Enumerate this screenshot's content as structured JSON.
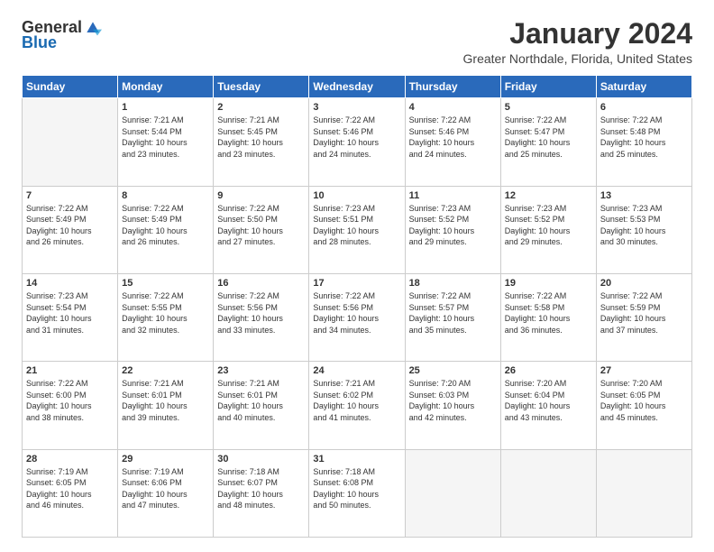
{
  "logo": {
    "general": "General",
    "blue": "Blue"
  },
  "header": {
    "month": "January 2024",
    "location": "Greater Northdale, Florida, United States"
  },
  "days_of_week": [
    "Sunday",
    "Monday",
    "Tuesday",
    "Wednesday",
    "Thursday",
    "Friday",
    "Saturday"
  ],
  "weeks": [
    [
      {
        "day": "",
        "sunrise": "",
        "sunset": "",
        "daylight": ""
      },
      {
        "day": "1",
        "sunrise": "Sunrise: 7:21 AM",
        "sunset": "Sunset: 5:44 PM",
        "daylight": "Daylight: 10 hours and 23 minutes."
      },
      {
        "day": "2",
        "sunrise": "Sunrise: 7:21 AM",
        "sunset": "Sunset: 5:45 PM",
        "daylight": "Daylight: 10 hours and 23 minutes."
      },
      {
        "day": "3",
        "sunrise": "Sunrise: 7:22 AM",
        "sunset": "Sunset: 5:46 PM",
        "daylight": "Daylight: 10 hours and 24 minutes."
      },
      {
        "day": "4",
        "sunrise": "Sunrise: 7:22 AM",
        "sunset": "Sunset: 5:46 PM",
        "daylight": "Daylight: 10 hours and 24 minutes."
      },
      {
        "day": "5",
        "sunrise": "Sunrise: 7:22 AM",
        "sunset": "Sunset: 5:47 PM",
        "daylight": "Daylight: 10 hours and 25 minutes."
      },
      {
        "day": "6",
        "sunrise": "Sunrise: 7:22 AM",
        "sunset": "Sunset: 5:48 PM",
        "daylight": "Daylight: 10 hours and 25 minutes."
      }
    ],
    [
      {
        "day": "7",
        "sunrise": "Sunrise: 7:22 AM",
        "sunset": "Sunset: 5:49 PM",
        "daylight": "Daylight: 10 hours and 26 minutes."
      },
      {
        "day": "8",
        "sunrise": "Sunrise: 7:22 AM",
        "sunset": "Sunset: 5:49 PM",
        "daylight": "Daylight: 10 hours and 26 minutes."
      },
      {
        "day": "9",
        "sunrise": "Sunrise: 7:22 AM",
        "sunset": "Sunset: 5:50 PM",
        "daylight": "Daylight: 10 hours and 27 minutes."
      },
      {
        "day": "10",
        "sunrise": "Sunrise: 7:23 AM",
        "sunset": "Sunset: 5:51 PM",
        "daylight": "Daylight: 10 hours and 28 minutes."
      },
      {
        "day": "11",
        "sunrise": "Sunrise: 7:23 AM",
        "sunset": "Sunset: 5:52 PM",
        "daylight": "Daylight: 10 hours and 29 minutes."
      },
      {
        "day": "12",
        "sunrise": "Sunrise: 7:23 AM",
        "sunset": "Sunset: 5:52 PM",
        "daylight": "Daylight: 10 hours and 29 minutes."
      },
      {
        "day": "13",
        "sunrise": "Sunrise: 7:23 AM",
        "sunset": "Sunset: 5:53 PM",
        "daylight": "Daylight: 10 hours and 30 minutes."
      }
    ],
    [
      {
        "day": "14",
        "sunrise": "Sunrise: 7:23 AM",
        "sunset": "Sunset: 5:54 PM",
        "daylight": "Daylight: 10 hours and 31 minutes."
      },
      {
        "day": "15",
        "sunrise": "Sunrise: 7:22 AM",
        "sunset": "Sunset: 5:55 PM",
        "daylight": "Daylight: 10 hours and 32 minutes."
      },
      {
        "day": "16",
        "sunrise": "Sunrise: 7:22 AM",
        "sunset": "Sunset: 5:56 PM",
        "daylight": "Daylight: 10 hours and 33 minutes."
      },
      {
        "day": "17",
        "sunrise": "Sunrise: 7:22 AM",
        "sunset": "Sunset: 5:56 PM",
        "daylight": "Daylight: 10 hours and 34 minutes."
      },
      {
        "day": "18",
        "sunrise": "Sunrise: 7:22 AM",
        "sunset": "Sunset: 5:57 PM",
        "daylight": "Daylight: 10 hours and 35 minutes."
      },
      {
        "day": "19",
        "sunrise": "Sunrise: 7:22 AM",
        "sunset": "Sunset: 5:58 PM",
        "daylight": "Daylight: 10 hours and 36 minutes."
      },
      {
        "day": "20",
        "sunrise": "Sunrise: 7:22 AM",
        "sunset": "Sunset: 5:59 PM",
        "daylight": "Daylight: 10 hours and 37 minutes."
      }
    ],
    [
      {
        "day": "21",
        "sunrise": "Sunrise: 7:22 AM",
        "sunset": "Sunset: 6:00 PM",
        "daylight": "Daylight: 10 hours and 38 minutes."
      },
      {
        "day": "22",
        "sunrise": "Sunrise: 7:21 AM",
        "sunset": "Sunset: 6:01 PM",
        "daylight": "Daylight: 10 hours and 39 minutes."
      },
      {
        "day": "23",
        "sunrise": "Sunrise: 7:21 AM",
        "sunset": "Sunset: 6:01 PM",
        "daylight": "Daylight: 10 hours and 40 minutes."
      },
      {
        "day": "24",
        "sunrise": "Sunrise: 7:21 AM",
        "sunset": "Sunset: 6:02 PM",
        "daylight": "Daylight: 10 hours and 41 minutes."
      },
      {
        "day": "25",
        "sunrise": "Sunrise: 7:20 AM",
        "sunset": "Sunset: 6:03 PM",
        "daylight": "Daylight: 10 hours and 42 minutes."
      },
      {
        "day": "26",
        "sunrise": "Sunrise: 7:20 AM",
        "sunset": "Sunset: 6:04 PM",
        "daylight": "Daylight: 10 hours and 43 minutes."
      },
      {
        "day": "27",
        "sunrise": "Sunrise: 7:20 AM",
        "sunset": "Sunset: 6:05 PM",
        "daylight": "Daylight: 10 hours and 45 minutes."
      }
    ],
    [
      {
        "day": "28",
        "sunrise": "Sunrise: 7:19 AM",
        "sunset": "Sunset: 6:05 PM",
        "daylight": "Daylight: 10 hours and 46 minutes."
      },
      {
        "day": "29",
        "sunrise": "Sunrise: 7:19 AM",
        "sunset": "Sunset: 6:06 PM",
        "daylight": "Daylight: 10 hours and 47 minutes."
      },
      {
        "day": "30",
        "sunrise": "Sunrise: 7:18 AM",
        "sunset": "Sunset: 6:07 PM",
        "daylight": "Daylight: 10 hours and 48 minutes."
      },
      {
        "day": "31",
        "sunrise": "Sunrise: 7:18 AM",
        "sunset": "Sunset: 6:08 PM",
        "daylight": "Daylight: 10 hours and 50 minutes."
      },
      {
        "day": "",
        "sunrise": "",
        "sunset": "",
        "daylight": ""
      },
      {
        "day": "",
        "sunrise": "",
        "sunset": "",
        "daylight": ""
      },
      {
        "day": "",
        "sunrise": "",
        "sunset": "",
        "daylight": ""
      }
    ]
  ]
}
